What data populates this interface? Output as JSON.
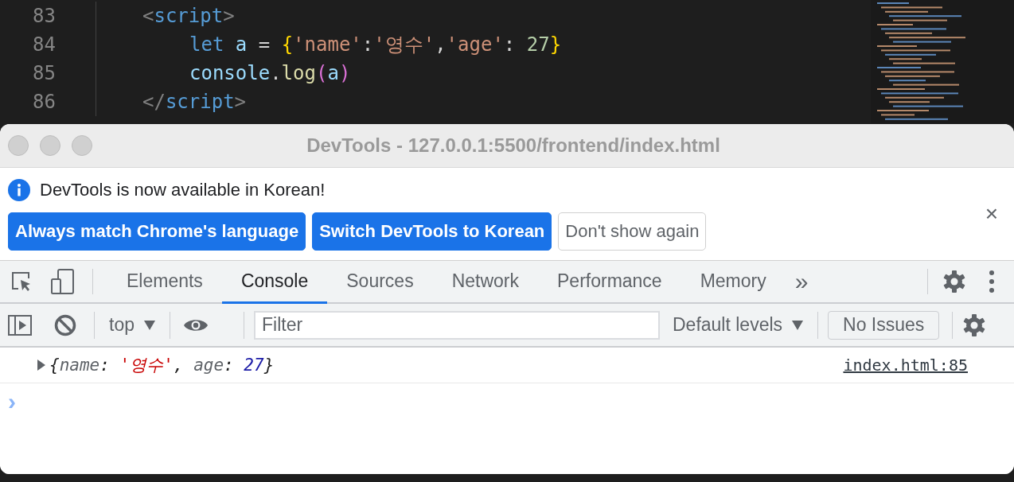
{
  "editor": {
    "lines": [
      {
        "number": "83",
        "inner": false,
        "tokens": [
          {
            "text": "<",
            "kind": "punct"
          },
          {
            "text": "script",
            "kind": "tag"
          },
          {
            "text": ">",
            "kind": "punct"
          }
        ]
      },
      {
        "number": "84",
        "inner": true,
        "tokens": [
          {
            "text": "let",
            "kind": "keyword"
          },
          {
            "text": " a ",
            "kind": "var"
          },
          {
            "text": "= ",
            "kind": "plain"
          },
          {
            "text": "{",
            "kind": "brace"
          },
          {
            "text": "'name'",
            "kind": "string"
          },
          {
            "text": ":",
            "kind": "plain"
          },
          {
            "text": "'영수'",
            "kind": "string"
          },
          {
            "text": ",",
            "kind": "plain"
          },
          {
            "text": "'age'",
            "kind": "string"
          },
          {
            "text": ": ",
            "kind": "plain"
          },
          {
            "text": "27",
            "kind": "number"
          },
          {
            "text": "}",
            "kind": "brace"
          }
        ]
      },
      {
        "number": "85",
        "inner": true,
        "tokens": [
          {
            "text": "console",
            "kind": "var"
          },
          {
            "text": ".",
            "kind": "plain"
          },
          {
            "text": "log",
            "kind": "func"
          },
          {
            "text": "(",
            "kind": "brace2"
          },
          {
            "text": "a",
            "kind": "var"
          },
          {
            "text": ")",
            "kind": "brace2"
          }
        ]
      },
      {
        "number": "86",
        "inner": false,
        "tokens": [
          {
            "text": "</",
            "kind": "punct"
          },
          {
            "text": "script",
            "kind": "tag"
          },
          {
            "text": ">",
            "kind": "punct"
          }
        ]
      }
    ]
  },
  "window": {
    "title": "DevTools - 127.0.0.1:5500/frontend/index.html"
  },
  "infobar": {
    "message": "DevTools is now available in Korean!",
    "buttons": [
      {
        "label": "Always match Chrome's language",
        "kind": "primary"
      },
      {
        "label": "Switch DevTools to Korean",
        "kind": "primary"
      },
      {
        "label": "Don't show again",
        "kind": "secondary"
      }
    ],
    "close": "×"
  },
  "tabs": [
    {
      "label": "Elements",
      "selected": false
    },
    {
      "label": "Console",
      "selected": true
    },
    {
      "label": "Sources",
      "selected": false
    },
    {
      "label": "Network",
      "selected": false
    },
    {
      "label": "Performance",
      "selected": false
    },
    {
      "label": "Memory",
      "selected": false
    }
  ],
  "more_tabs": "»",
  "console_toolbar": {
    "context": "top",
    "filter": {
      "placeholder": "Filter"
    },
    "levels": "Default levels",
    "issues": "No Issues"
  },
  "messages": [
    {
      "expanded": false,
      "tokens": [
        {
          "text": "{",
          "kind": "punct"
        },
        {
          "text": "name",
          "kind": "key"
        },
        {
          "text": ": ",
          "kind": "punct"
        },
        {
          "text": "'영수'",
          "kind": "string"
        },
        {
          "text": ", ",
          "kind": "punct"
        },
        {
          "text": "age",
          "kind": "key"
        },
        {
          "text": ": ",
          "kind": "punct"
        },
        {
          "text": "27",
          "kind": "number"
        },
        {
          "text": "}",
          "kind": "punct"
        }
      ],
      "source": "index.html:85"
    }
  ],
  "prompt": "›"
}
